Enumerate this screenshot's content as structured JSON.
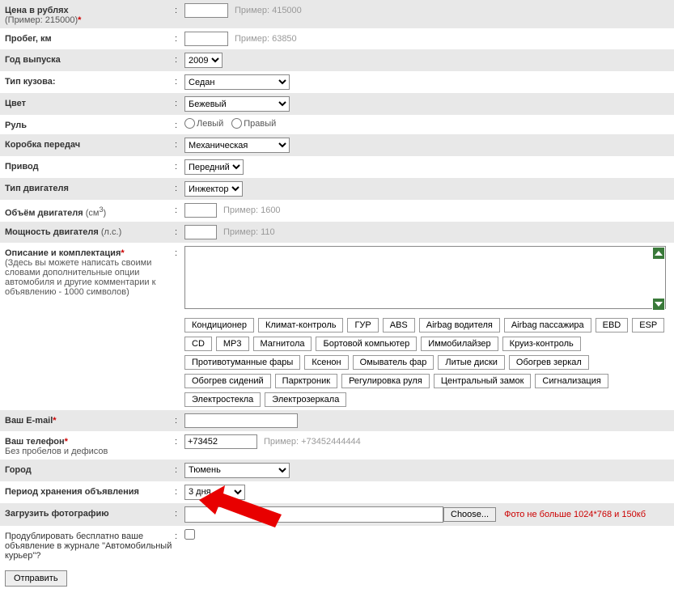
{
  "price": {
    "label": "Цена в рублях",
    "sublabel": "(Пример: 215000)",
    "hint": "Пример: 415000"
  },
  "mileage": {
    "label": "Пробег, км",
    "hint": "Пример: 63850"
  },
  "year": {
    "label": "Год выпуска",
    "value": "2009"
  },
  "body": {
    "label": "Тип кузова:",
    "value": "Седан"
  },
  "color": {
    "label": "Цвет",
    "value": "Бежевый"
  },
  "steering": {
    "label": "Руль",
    "left": "Левый",
    "right": "Правый"
  },
  "gearbox": {
    "label": "Коробка передач",
    "value": "Механическая"
  },
  "drive": {
    "label": "Привод",
    "value": "Передний"
  },
  "engine": {
    "label": "Тип двигателя",
    "value": "Инжектор"
  },
  "volume": {
    "label_a": "Объём двигателя",
    "label_b": " (см",
    "label_c": ")",
    "sup": "3",
    "hint": "Пример: 1600"
  },
  "power": {
    "label_a": "Мощность двигателя",
    "label_b": " (л.с.)",
    "hint": "Пример: 110"
  },
  "desc": {
    "label": "Описание и комплектация",
    "sublabel": "(Здесь вы можете написать своими словами дополнительные опции автомобиля и другие комментарии к объявлению - 1000 символов)"
  },
  "tags": [
    "Кондиционер",
    "Климат-контроль",
    "ГУР",
    "ABS",
    "Airbag водителя",
    "Airbag пассажира",
    "EBD",
    "ESP",
    "CD",
    "MP3",
    "Магнитола",
    "Бортовой компьютер",
    "Иммобилайзер",
    "Круиз-контроль",
    "Противотуманные фары",
    "Ксенон",
    "Омыватель фар",
    "Литые диски",
    "Обогрев зеркал",
    "Обогрев сидений",
    "Парктроник",
    "Регулировка руля",
    "Центральный замок",
    "Сигнализация",
    "Электростекла",
    "Электрозеркала"
  ],
  "email": {
    "label": "Ваш E-mail"
  },
  "phone": {
    "label": "Ваш телефон",
    "sublabel": "Без пробелов и дефисов",
    "value": "+73452",
    "hint": "Пример: +73452444444"
  },
  "city": {
    "label": "Город",
    "value": "Тюмень"
  },
  "period": {
    "label": "Период хранения объявления",
    "value": "3 дня"
  },
  "photo": {
    "label": "Загрузить фотографию",
    "choose": "Choose...",
    "note": "Фото не больше 1024*768 и 150кб"
  },
  "duplicate": {
    "label": "Продублировать бесплатно ваше объявление в журнале \"Автомобильный курьер\"?"
  },
  "submit": {
    "label": "Отправить"
  }
}
